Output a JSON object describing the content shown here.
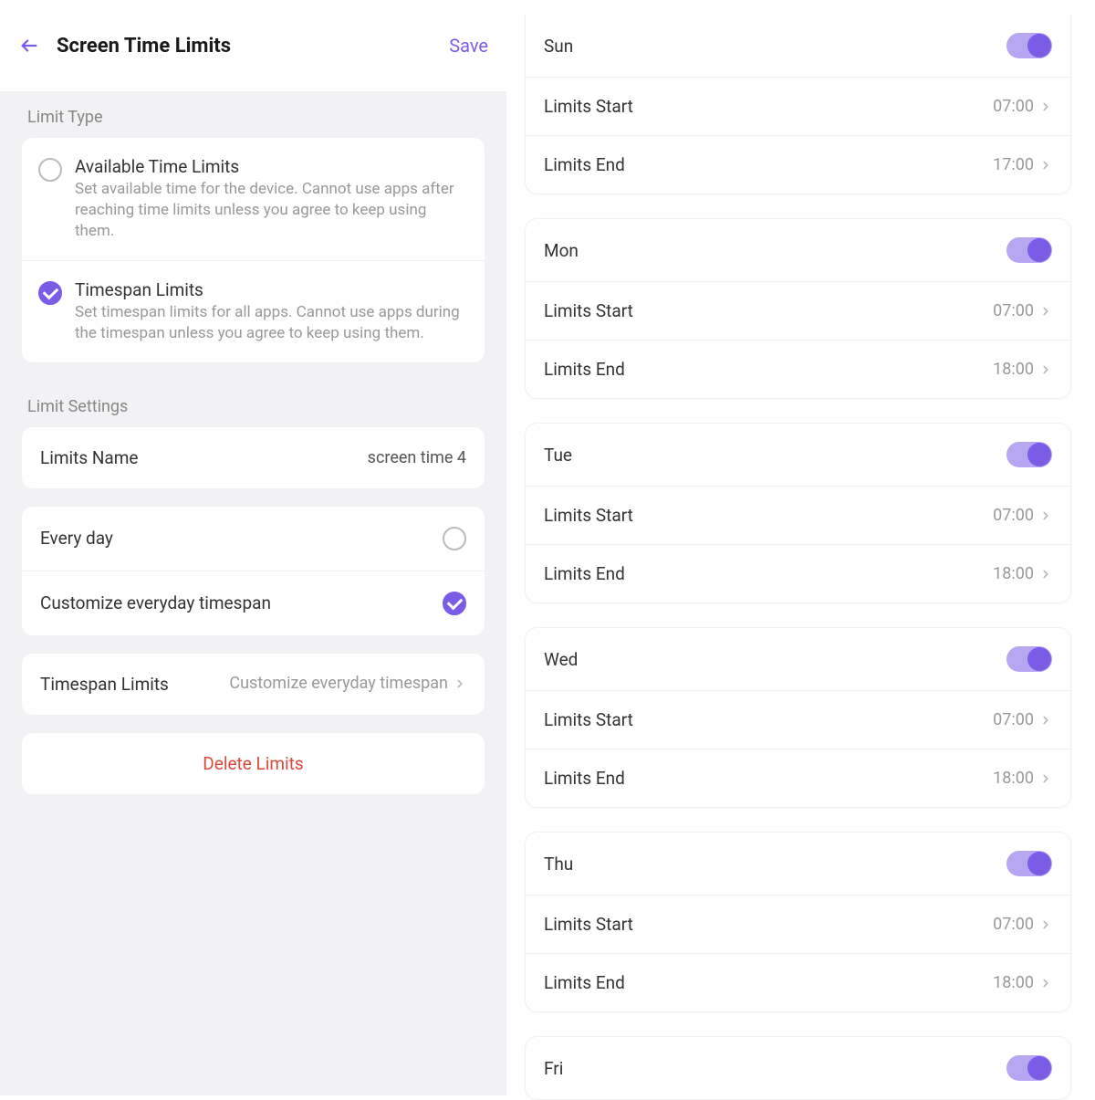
{
  "header": {
    "title": "Screen Time Limits",
    "save": "Save"
  },
  "sections": {
    "limit_type": "Limit Type",
    "limit_settings": "Limit Settings"
  },
  "limit_type_options": {
    "available": {
      "title": "Available Time Limits",
      "desc": "Set available time for the device. Cannot use apps after reaching time limits unless you agree to keep using them.",
      "checked": false
    },
    "timespan": {
      "title": "Timespan Limits",
      "desc": "Set timespan limits for all apps. Cannot use apps during the timespan unless you agree to keep using them.",
      "checked": true
    }
  },
  "limits_name": {
    "label": "Limits Name",
    "value": "screen time 4"
  },
  "schedule_mode": {
    "every_day": {
      "label": "Every day",
      "checked": false
    },
    "customize": {
      "label": "Customize everyday timespan",
      "checked": true
    }
  },
  "timespan_summary": {
    "label": "Timespan Limits",
    "value": "Customize everyday timespan"
  },
  "delete_label": "Delete Limits",
  "row_labels": {
    "start": "Limits Start",
    "end": "Limits End"
  },
  "days": [
    {
      "name": "Sun",
      "enabled": true,
      "start": "07:00",
      "end": "17:00"
    },
    {
      "name": "Mon",
      "enabled": true,
      "start": "07:00",
      "end": "18:00"
    },
    {
      "name": "Tue",
      "enabled": true,
      "start": "07:00",
      "end": "18:00"
    },
    {
      "name": "Wed",
      "enabled": true,
      "start": "07:00",
      "end": "18:00"
    },
    {
      "name": "Thu",
      "enabled": true,
      "start": "07:00",
      "end": "18:00"
    },
    {
      "name": "Fri",
      "enabled": true,
      "start": "",
      "end": ""
    }
  ]
}
